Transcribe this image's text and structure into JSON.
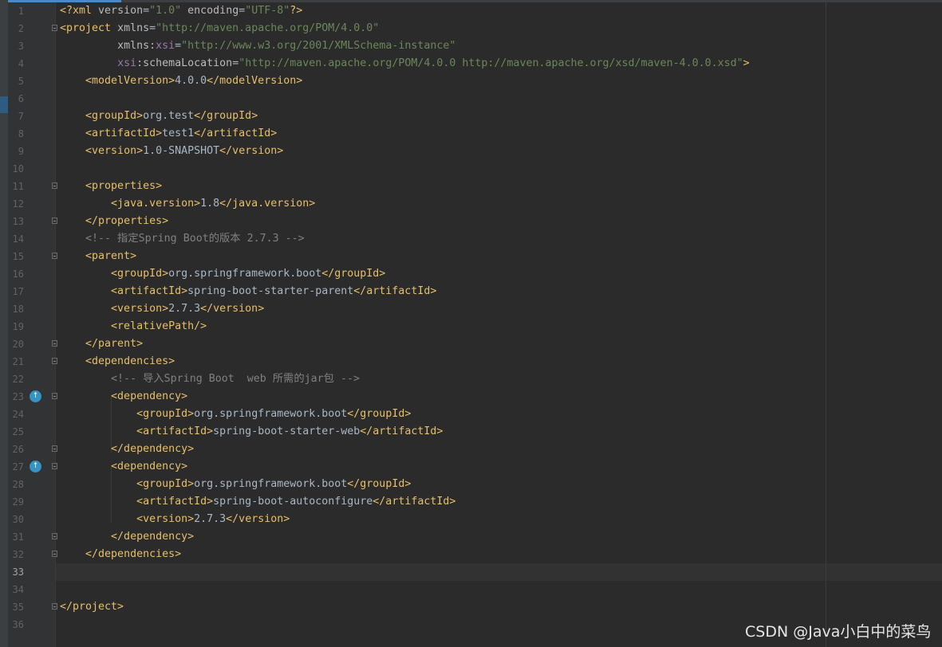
{
  "editor": {
    "language": "xml",
    "current_line": 33,
    "colors": {
      "background": "#2b2b2b",
      "gutter": "#313335",
      "tag": "#e8bf6a",
      "attribute": "#bababa",
      "namespace": "#9876aa",
      "string": "#6a8759",
      "comment": "#808080",
      "text": "#a9b7c6",
      "line_number": "#606366"
    },
    "lines": [
      {
        "n": "1",
        "tokens": [
          [
            "pi",
            "<?xml "
          ],
          [
            "attr",
            "version"
          ],
          [
            "text",
            "="
          ],
          [
            "val",
            "\"1.0\""
          ],
          [
            "text",
            " "
          ],
          [
            "attr",
            "encoding"
          ],
          [
            "text",
            "="
          ],
          [
            "val",
            "\"UTF-8\""
          ],
          [
            "pi",
            "?>"
          ]
        ]
      },
      {
        "n": "2",
        "fold": true,
        "tokens": [
          [
            "tag",
            "<project"
          ],
          [
            "text",
            " "
          ],
          [
            "attr",
            "xmlns"
          ],
          [
            "text",
            "="
          ],
          [
            "val",
            "\"http://maven.apache.org/POM/4.0.0\""
          ]
        ]
      },
      {
        "n": "3",
        "tokens": [
          [
            "text",
            "         "
          ],
          [
            "attr",
            "xmlns"
          ],
          [
            "text",
            ":"
          ],
          [
            "ns",
            "xsi"
          ],
          [
            "text",
            "="
          ],
          [
            "val",
            "\"http://www.w3.org/2001/XMLSchema-instance\""
          ]
        ]
      },
      {
        "n": "4",
        "tokens": [
          [
            "text",
            "         "
          ],
          [
            "ns",
            "xsi"
          ],
          [
            "text",
            ":"
          ],
          [
            "attr",
            "schemaLocation"
          ],
          [
            "text",
            "="
          ],
          [
            "val",
            "\"http://maven.apache.org/POM/4.0.0 http://maven.apache.org/xsd/maven-4.0.0.xsd\""
          ],
          [
            "tag",
            ">"
          ]
        ]
      },
      {
        "n": "5",
        "tokens": [
          [
            "text",
            "    "
          ],
          [
            "tag",
            "<modelVersion>"
          ],
          [
            "text",
            "4.0.0"
          ],
          [
            "tag",
            "</modelVersion>"
          ]
        ]
      },
      {
        "n": "6",
        "tokens": []
      },
      {
        "n": "7",
        "tokens": [
          [
            "text",
            "    "
          ],
          [
            "tag",
            "<groupId>"
          ],
          [
            "text",
            "org.test"
          ],
          [
            "tag",
            "</groupId>"
          ]
        ]
      },
      {
        "n": "8",
        "tokens": [
          [
            "text",
            "    "
          ],
          [
            "tag",
            "<artifactId>"
          ],
          [
            "text",
            "test1"
          ],
          [
            "tag",
            "</artifactId>"
          ]
        ]
      },
      {
        "n": "9",
        "tokens": [
          [
            "text",
            "    "
          ],
          [
            "tag",
            "<version>"
          ],
          [
            "text",
            "1.0-SNAPSHOT"
          ],
          [
            "tag",
            "</version>"
          ]
        ]
      },
      {
        "n": "10",
        "tokens": []
      },
      {
        "n": "11",
        "fold": true,
        "tokens": [
          [
            "text",
            "    "
          ],
          [
            "tag",
            "<properties>"
          ]
        ]
      },
      {
        "n": "12",
        "tokens": [
          [
            "text",
            "        "
          ],
          [
            "tag",
            "<java.version>"
          ],
          [
            "text",
            "1.8"
          ],
          [
            "tag",
            "</java.version>"
          ]
        ]
      },
      {
        "n": "13",
        "fold": true,
        "tokens": [
          [
            "text",
            "    "
          ],
          [
            "tag",
            "</properties>"
          ]
        ]
      },
      {
        "n": "14",
        "tokens": [
          [
            "text",
            "    "
          ],
          [
            "cmt",
            "<!-- 指定Spring Boot的版本 2.7.3 -->"
          ]
        ]
      },
      {
        "n": "15",
        "fold": true,
        "tokens": [
          [
            "text",
            "    "
          ],
          [
            "tag",
            "<parent>"
          ]
        ]
      },
      {
        "n": "16",
        "tokens": [
          [
            "text",
            "        "
          ],
          [
            "tag",
            "<groupId>"
          ],
          [
            "text",
            "org.springframework.boot"
          ],
          [
            "tag",
            "</groupId>"
          ]
        ]
      },
      {
        "n": "17",
        "tokens": [
          [
            "text",
            "        "
          ],
          [
            "tag",
            "<artifactId>"
          ],
          [
            "text",
            "spring-boot-starter-parent"
          ],
          [
            "tag",
            "</artifactId>"
          ]
        ]
      },
      {
        "n": "18",
        "tokens": [
          [
            "text",
            "        "
          ],
          [
            "tag",
            "<version>"
          ],
          [
            "text",
            "2.7.3"
          ],
          [
            "tag",
            "</version>"
          ]
        ]
      },
      {
        "n": "19",
        "tokens": [
          [
            "text",
            "        "
          ],
          [
            "tag",
            "<relativePath/>"
          ]
        ]
      },
      {
        "n": "20",
        "fold": true,
        "tokens": [
          [
            "text",
            "    "
          ],
          [
            "tag",
            "</parent>"
          ]
        ]
      },
      {
        "n": "21",
        "fold": true,
        "tokens": [
          [
            "text",
            "    "
          ],
          [
            "tag",
            "<dependencies>"
          ]
        ]
      },
      {
        "n": "22",
        "tokens": [
          [
            "text",
            "        "
          ],
          [
            "cmt",
            "<!-- 导入Spring Boot  web 所需的jar包 -->"
          ]
        ]
      },
      {
        "n": "23",
        "fold": true,
        "gutter_icon": "maven-dependency-icon",
        "tokens": [
          [
            "text",
            "        "
          ],
          [
            "tag",
            "<dependency>"
          ]
        ]
      },
      {
        "n": "24",
        "tokens": [
          [
            "text",
            "            "
          ],
          [
            "tag",
            "<groupId>"
          ],
          [
            "text",
            "org.springframework.boot"
          ],
          [
            "tag",
            "</groupId>"
          ]
        ]
      },
      {
        "n": "25",
        "tokens": [
          [
            "text",
            "            "
          ],
          [
            "tag",
            "<artifactId>"
          ],
          [
            "text",
            "spring-boot-starter-web"
          ],
          [
            "tag",
            "</artifactId>"
          ]
        ]
      },
      {
        "n": "26",
        "fold": true,
        "tokens": [
          [
            "text",
            "        "
          ],
          [
            "tag",
            "</dependency>"
          ]
        ]
      },
      {
        "n": "27",
        "fold": true,
        "gutter_icon": "maven-dependency-icon",
        "tokens": [
          [
            "text",
            "        "
          ],
          [
            "tag",
            "<dependency>"
          ]
        ]
      },
      {
        "n": "28",
        "tokens": [
          [
            "text",
            "            "
          ],
          [
            "tag",
            "<groupId>"
          ],
          [
            "text",
            "org.springframework.boot"
          ],
          [
            "tag",
            "</groupId>"
          ]
        ]
      },
      {
        "n": "29",
        "tokens": [
          [
            "text",
            "            "
          ],
          [
            "tag",
            "<artifactId>"
          ],
          [
            "text",
            "spring-boot-autoconfigure"
          ],
          [
            "tag",
            "</artifactId>"
          ]
        ]
      },
      {
        "n": "30",
        "tokens": [
          [
            "text",
            "            "
          ],
          [
            "tag",
            "<version>"
          ],
          [
            "text",
            "2.7.3"
          ],
          [
            "tag",
            "</version>"
          ]
        ]
      },
      {
        "n": "31",
        "fold": true,
        "tokens": [
          [
            "text",
            "        "
          ],
          [
            "tag",
            "</dependency>"
          ]
        ]
      },
      {
        "n": "32",
        "fold": true,
        "tokens": [
          [
            "text",
            "    "
          ],
          [
            "tag",
            "</dependencies>"
          ]
        ]
      },
      {
        "n": "33",
        "tokens": []
      },
      {
        "n": "34",
        "tokens": []
      },
      {
        "n": "35",
        "fold": true,
        "tokens": [
          [
            "tag",
            "</project>"
          ]
        ]
      },
      {
        "n": "36",
        "tokens": []
      }
    ]
  },
  "watermark": {
    "text": "CSDN @Java小白中的菜鸟"
  }
}
